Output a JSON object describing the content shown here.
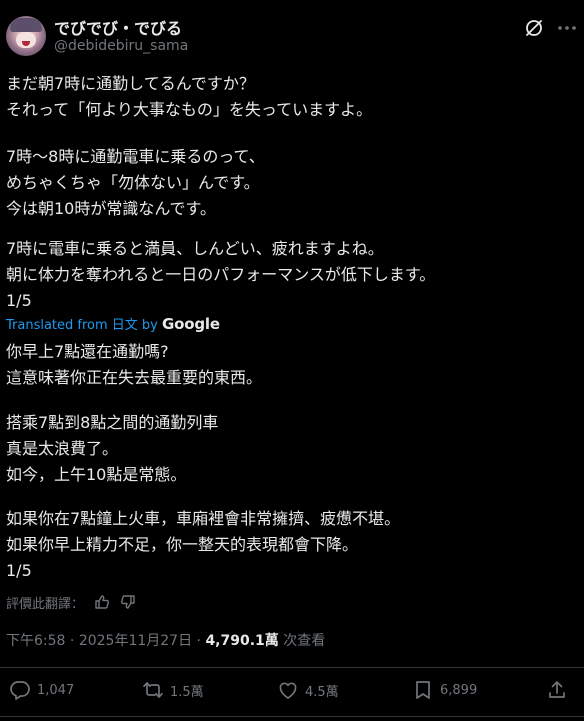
{
  "author": {
    "display_name": "でびでび・でびる",
    "handle": "@debidebiru_sama",
    "avatar_icon": "avatar-image"
  },
  "original_paragraphs": [
    "まだ朝7時に通勤してるんですか？\nそれって「何より大事なもの」を失っていますよ。",
    "7時〜8時に通勤電車に乗るのって、\nめちゃくちゃ「勿体ない」んです。\n今は朝10時が常識なんです。",
    "7時に電車に乗ると満員、しんどい、疲れますよね。\n朝に体力を奪われると一日のパフォーマンスが低下します。\n1/5"
  ],
  "translation_notice": {
    "prefix": "Translated from 日文 by ",
    "provider": "Google"
  },
  "translated_paragraphs": [
    "你早上7點還在通勤嗎?\n這意味著你正在失去最重要的東西。",
    "搭乘7點到8點之間的通勤列車\n真是太浪費了。\n如今，上午10點是常態。",
    "如果你在7點鐘上火車，車廂裡會非常擁擠、疲憊不堪。\n如果你早上精力不足，你一整天的表現都會下降。\n1/5"
  ],
  "rate_translation": {
    "label": "評價此翻譯：",
    "thumbs_up_icon": "thumbs-up-icon",
    "thumbs_down_icon": "thumbs-down-icon"
  },
  "meta": {
    "time": "下午6:58",
    "separator": "·",
    "date": "2025年11月27日",
    "views_count": "4,790.1萬",
    "views_label": "次查看"
  },
  "actions": {
    "replies": "1,047",
    "reposts": "1.5萬",
    "likes": "4.5萬",
    "bookmarks": "6,899"
  },
  "colors": {
    "background": "#000000",
    "text": "#e7e9ea",
    "secondary": "#71767b",
    "link": "#1d9bf0",
    "divider": "#2f3336"
  }
}
